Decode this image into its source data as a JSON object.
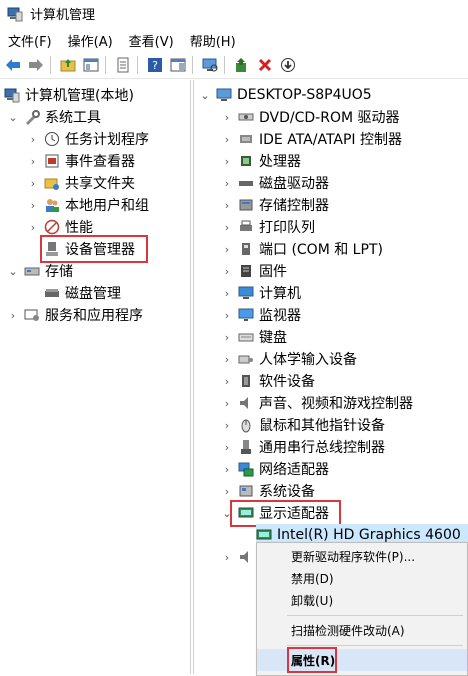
{
  "window": {
    "title": "计算机管理"
  },
  "menu": {
    "file": "文件(F)",
    "action": "操作(A)",
    "view": "查看(V)",
    "help": "帮助(H)"
  },
  "left_tree": {
    "root": "计算机管理(本地)",
    "system_tools": "系统工具",
    "task_scheduler": "任务计划程序",
    "event_viewer": "事件查看器",
    "shared_folders": "共享文件夹",
    "local_users": "本地用户和组",
    "performance": "性能",
    "device_manager": "设备管理器",
    "storage": "存储",
    "disk_management": "磁盘管理",
    "services_apps": "服务和应用程序"
  },
  "devices": {
    "computer_name": "DESKTOP-S8P4UO5",
    "categories": [
      "DVD/CD-ROM 驱动器",
      "IDE ATA/ATAPI 控制器",
      "处理器",
      "磁盘驱动器",
      "存储控制器",
      "打印队列",
      "端口 (COM 和 LPT)",
      "固件",
      "计算机",
      "监视器",
      "键盘",
      "人体学输入设备",
      "软件设备",
      "声音、视频和游戏控制器",
      "鼠标和其他指针设备",
      "通用串行总线控制器",
      "网络适配器",
      "系统设备",
      "显示适配器"
    ],
    "display_child": "Intel(R) HD Graphics 4600"
  },
  "context_menu": {
    "update_driver": "更新驱动程序软件(P)...",
    "disable": "禁用(D)",
    "uninstall": "卸载(U)",
    "scan": "扫描检测硬件改动(A)",
    "properties": "属性(R)"
  },
  "colors": {
    "highlight_border": "#d9363e",
    "selection_bg": "#cce8ff"
  }
}
